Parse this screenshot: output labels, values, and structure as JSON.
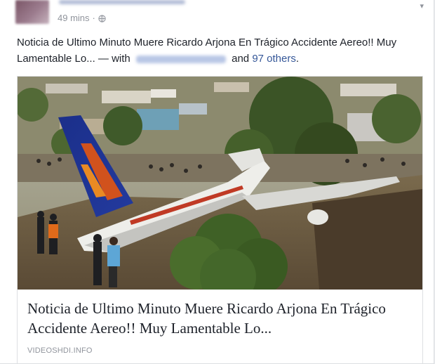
{
  "post": {
    "timestamp": "49 mins",
    "separator": "·",
    "privacy_icon": "globe-icon",
    "text_main": "Noticia de Ultimo Minuto Muere Ricardo Arjona En Trágico Accidente Aereo!! Muy Lamentable Lo...",
    "text_with": "— with",
    "text_and": "and",
    "others_link": "97 others",
    "text_end": "."
  },
  "link_card": {
    "image": "airplane-crash-photo",
    "title": "Noticia de Ultimo Minuto Muere Ricardo Arjona En Trágico Accidente Aereo!! Muy Lamentable Lo...",
    "domain": "VIDEOSHDI.INFO"
  },
  "colors": {
    "link": "#365899",
    "meta_text": "#90949c",
    "body_text": "#1d2129"
  }
}
